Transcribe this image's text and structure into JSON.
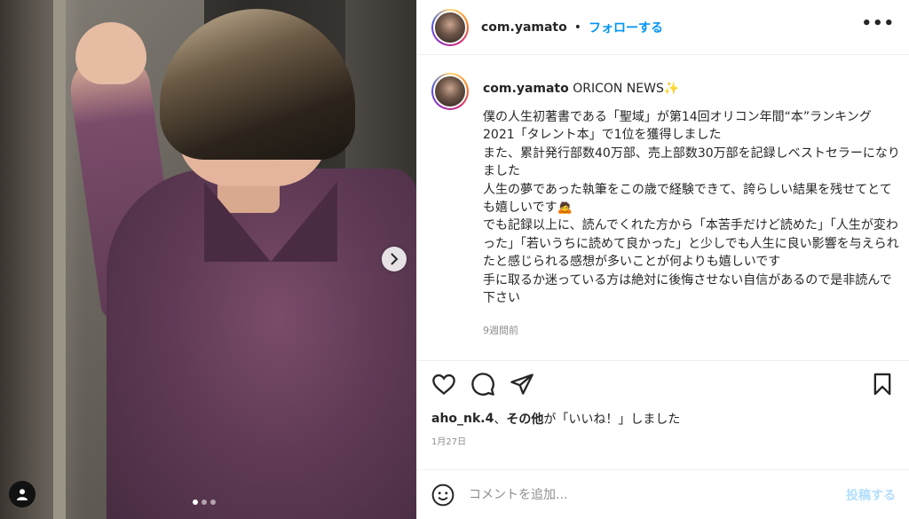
{
  "header": {
    "username": "com.yamato",
    "separator": "•",
    "follow_label": "フォローする",
    "more_label": "•••"
  },
  "caption": {
    "username": "com.yamato",
    "tagline": "ORICON NEWS✨",
    "text": "僕の人生初著書である「聖域」が第14回オリコン年間“本”ランキング2021「タレント本」で1位を獲得しました\nまた、累計発行部数40万部、売上部数30万部を記録しベストセラーになりました\n人生の夢であった執筆をこの歳で経験できて、誇らしい結果を残せてとても嬉しいです🙇\nでも記録以上に、読んでくれた方から「本苦手だけど読めた」「人生が変わった」「若いうちに読めて良かった」と少しでも人生に良い影響を与えられたと感じられる感想が多いことが何よりも嬉しいです\n手に取るか迷っている方は絶対に後悔させない自信があるので是非読んで下さい",
    "timestamp": "9週間前"
  },
  "actions": {
    "icons": [
      "heart-icon",
      "comment-icon",
      "share-icon",
      "bookmark-icon"
    ]
  },
  "likes": {
    "user": "aho_nk.4",
    "joiner": "、",
    "others": "その他",
    "suffix": "が「いいね！」しました"
  },
  "date": "1月27日",
  "comment": {
    "placeholder": "コメントを追加...",
    "post_label": "投稿する"
  },
  "carousel": {
    "slide_count": 3,
    "active_index": 0
  },
  "colors": {
    "link": "#0095f6",
    "post_disabled": "#b2dffc",
    "muted": "#8e8e8e"
  }
}
